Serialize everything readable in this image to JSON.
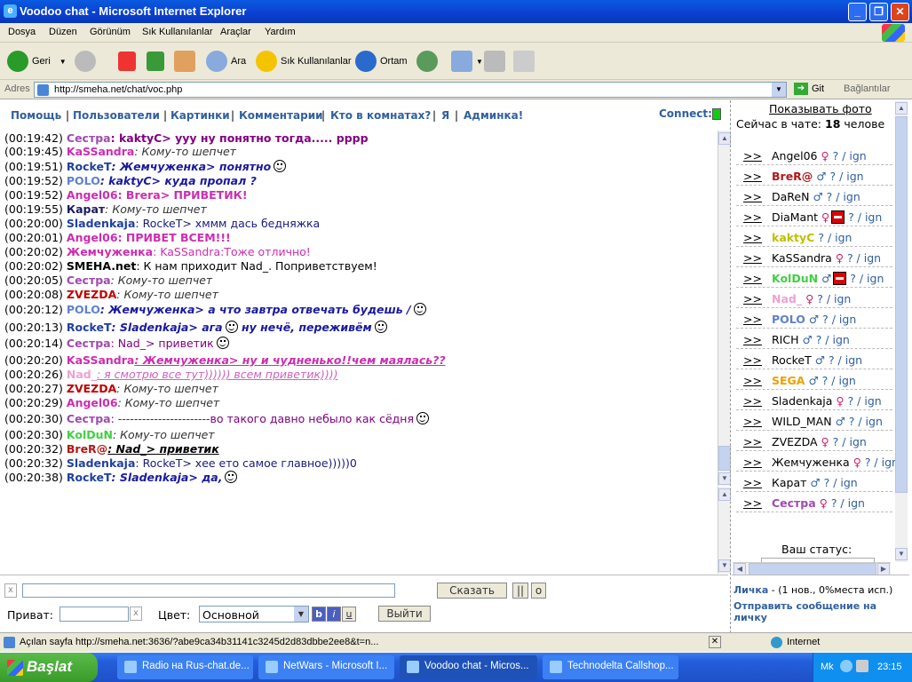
{
  "window": {
    "title": "Voodoo chat - Microsoft Internet Explorer",
    "minimize": "_",
    "maximize": "❐",
    "close": "✕"
  },
  "menu": [
    "Dosya",
    "Düzen",
    "Görünüm",
    "Sık Kullanılanlar",
    "Araçlar",
    "Yardım"
  ],
  "toolbar": {
    "back": "Geri",
    "search": "Ara",
    "favorites": "Sık Kullanılanlar",
    "media": "Ortam"
  },
  "address": {
    "label": "Adres",
    "url": "http://smeha.net/chat/voc.php",
    "go": "Git",
    "links": "Bağlantılar"
  },
  "nav": {
    "items": [
      "Помощь",
      "Пользователи",
      "Картинки",
      "Комментарии",
      "Кто в комнатах?",
      "Я",
      "Админка!"
    ],
    "connect": "Connect:"
  },
  "chat": [
    {
      "time": "(00:19:42)",
      "nick": "Сестра",
      "nick_color": "#a04ab0",
      "text": ": kaktyC> ууу ну понятно тогда..... рррр",
      "text_color": "#800080",
      "bold_text": true
    },
    {
      "time": "(00:19:45)",
      "nick": "KaSSandra",
      "nick_color": "#cc2db0",
      "text": ": Кому-то шепчет",
      "text_color": "#333",
      "italic": true
    },
    {
      "time": "(00:19:51)",
      "nick": "RockeT",
      "nick_color": "#2040a0",
      "text": ": Жемчуженка> понятно",
      "text_color": "#1a1aa0",
      "italic": true,
      "bold_text": true,
      "smiles": 1
    },
    {
      "time": "(00:19:52)",
      "nick": "POLO",
      "nick_color": "#6080d0",
      "text": ": kaktyC> куда пропал ?",
      "text_color": "#1a1aa0",
      "italic": true,
      "bold_text": true
    },
    {
      "time": "(00:19:52)",
      "nick": "Angel06",
      "nick_color": "#cc2db0",
      "text": ": Brera> ПРИВЕТИК!",
      "text_color": "#cc2db0",
      "bold_text": true
    },
    {
      "time": "(00:19:55)",
      "nick": "Карат",
      "nick_color": "#1a1a60",
      "text": ": Кому-то шепчет",
      "text_color": "#333",
      "italic": true
    },
    {
      "time": "(00:20:00)",
      "nick": "Sladenkaja",
      "nick_color": "#2040a0",
      "text": ": RockeT> хммм дась бедняжка",
      "text_color": "#1a1a80"
    },
    {
      "time": "(00:20:01)",
      "nick": "Angel06",
      "nick_color": "#cc2db0",
      "text": ": ПРИВЕТ ВСЕМ!!!",
      "text_color": "#cc2db0",
      "bold_text": true
    },
    {
      "time": "(00:20:02)",
      "nick": "Жемчуженка",
      "nick_color": "#cc2db0",
      "text": ": KaSSandra:Тоже отлично!",
      "text_color": "#cc2db0"
    },
    {
      "time": "(00:20:02)",
      "nick": "SMEHA.net",
      "nick_color": "#000000",
      "text": ": К нам приходит Nad_. Поприветствуем!",
      "text_color": "#000"
    },
    {
      "time": "(00:20:05)",
      "nick": "Сестра",
      "nick_color": "#a04ab0",
      "text": ": Кому-то шепчет",
      "text_color": "#333",
      "italic": true
    },
    {
      "time": "(00:20:08)",
      "nick": "ZVEZDA",
      "nick_color": "#c00000",
      "text": ": Кому-то шепчет",
      "text_color": "#333",
      "italic": true
    },
    {
      "time": "(00:20:12)",
      "nick": "POLO",
      "nick_color": "#6080d0",
      "text": ": Жемчуженка> а что завтра отвечать будешь /",
      "text_color": "#1a1aa0",
      "italic": true,
      "bold_text": true,
      "smiles": 1
    },
    {
      "time": "(00:20:13)",
      "nick": "RockeT",
      "nick_color": "#2040a0",
      "text": ": Sladenkaja> ага",
      "text_color": "#1a1aa0",
      "italic": true,
      "bold_text": true,
      "smiles": 1,
      "text2": " ну нечё, переживём",
      "smiles2": 1
    },
    {
      "time": "(00:20:14)",
      "nick": "Сестра",
      "nick_color": "#a04ab0",
      "text": ": Nad_> приветик",
      "text_color": "#800080",
      "smiles": 1
    },
    {
      "time": "(00:20:20)",
      "nick": "KaSSandra",
      "nick_color": "#cc2db0",
      "text": ": Жемчуженка> ну и чудненько!!чем маялась??",
      "text_color": "#cc2db0",
      "italic": true,
      "bold_text": true,
      "underline": true
    },
    {
      "time": "(00:20:26)",
      "nick": "Nad_",
      "nick_color": "#f0a0d0",
      "text": ": я смотрю все тут)))))) всем приветик))))",
      "text_color": "#d060c0",
      "italic": true,
      "underline": true
    },
    {
      "time": "(00:20:27)",
      "nick": "ZVEZDA",
      "nick_color": "#c00000",
      "text": ": Кому-то шепчет",
      "text_color": "#333",
      "italic": true
    },
    {
      "time": "(00:20:29)",
      "nick": "Angel06",
      "nick_color": "#cc2db0",
      "text": ": Кому-то шепчет",
      "text_color": "#333",
      "italic": true
    },
    {
      "time": "(00:20:30)",
      "nick": "Сестра",
      "nick_color": "#a04ab0",
      "text": ": -----------------------во такого давно небыло как сёдня",
      "text_color": "#800080",
      "smiles": 1
    },
    {
      "time": "(00:20:30)",
      "nick": "KolDuN",
      "nick_color": "#40d040",
      "text": ": Кому-то шепчет",
      "text_color": "#333",
      "italic": true
    },
    {
      "time": "(00:20:32)",
      "nick": "BreR@",
      "nick_color": "#b01818",
      "text": ": Nad_> приветик",
      "text_color": "#000",
      "italic": true,
      "bold_text": true,
      "underline": true
    },
    {
      "time": "(00:20:32)",
      "nick": "Sladenkaja",
      "nick_color": "#2040a0",
      "text": ": RockeT> хее ето самое главное)))))0",
      "text_color": "#1a1a80"
    },
    {
      "time": "(00:20:38)",
      "nick": "RockeT",
      "nick_color": "#2040a0",
      "text": ": Sladenkaja> да,",
      "text_color": "#1a1aa0",
      "italic": true,
      "bold_text": true,
      "smiles": 1
    }
  ],
  "users_panel": {
    "show_photo": "Показывать фото",
    "now_in_chat": "Сейчас в чате:",
    "count": "18",
    "count_suffix": "челове",
    "users": [
      {
        "go": ">>",
        "name": "Angel06",
        "color": "#000",
        "gender": "♀",
        "ban": false,
        "rest": "? / ign"
      },
      {
        "go": ">>",
        "name": "BreR@",
        "color": "#b01818",
        "gender": "♂",
        "ban": false,
        "rest": "? / ign"
      },
      {
        "go": ">>",
        "name": "DaReN",
        "color": "#000",
        "gender": "♂",
        "ban": false,
        "rest": "? / ign"
      },
      {
        "go": ">>",
        "name": "DiaMant",
        "color": "#000",
        "gender": "♀",
        "ban": true,
        "rest": "? / ign"
      },
      {
        "go": ">>",
        "name": "kaktyC",
        "color": "#c0c000",
        "gender": "",
        "ban": false,
        "rest": "? / ign"
      },
      {
        "go": ">>",
        "name": "KaSSandra",
        "color": "#000",
        "gender": "♀",
        "ban": false,
        "rest": "? / ign"
      },
      {
        "go": ">>",
        "name": "KolDuN",
        "color": "#40d040",
        "gender": "♂",
        "ban": true,
        "rest": "? / ign"
      },
      {
        "go": ">>",
        "name": "Nad_",
        "color": "#f0a0d0",
        "gender": "♀",
        "ban": false,
        "rest": "? / ign"
      },
      {
        "go": ">>",
        "name": "POLO",
        "color": "#6080d0",
        "gender": "♂",
        "ban": false,
        "rest": "? / ign"
      },
      {
        "go": ">>",
        "name": "RICH",
        "color": "#000",
        "gender": "♂",
        "ban": false,
        "rest": "? / ign"
      },
      {
        "go": ">>",
        "name": "RockeT",
        "color": "#000",
        "gender": "♂",
        "ban": false,
        "rest": "? / ign"
      },
      {
        "go": ">>",
        "name": "SEGA",
        "color": "#f0a000",
        "gender": "♂",
        "ban": false,
        "rest": "? / ign"
      },
      {
        "go": ">>",
        "name": "Sladenkaja",
        "color": "#000",
        "gender": "♀",
        "ban": false,
        "rest": "? / ign"
      },
      {
        "go": ">>",
        "name": "WILD_MAN",
        "color": "#000",
        "gender": "♂",
        "ban": false,
        "rest": "? / ign"
      },
      {
        "go": ">>",
        "name": "ZVEZDA",
        "color": "#000",
        "gender": "♀",
        "ban": false,
        "rest": "? / ign"
      },
      {
        "go": ">>",
        "name": "Жемчуженка",
        "color": "#000",
        "gender": "♀",
        "ban": false,
        "rest": "? / ign"
      },
      {
        "go": ">>",
        "name": "Карат",
        "color": "#000",
        "gender": "♂",
        "ban": false,
        "rest": "? / ign"
      },
      {
        "go": ">>",
        "name": "Сестра",
        "color": "#a04ab0",
        "gender": "♀",
        "ban": false,
        "rest": "? / ign"
      }
    ],
    "status_label": "Ваш статус:"
  },
  "input": {
    "clear": "x",
    "say": "Сказать",
    "pause": "||",
    "o": "o",
    "privat_label": "Приват:",
    "privat_clear": "x",
    "color_label": "Цвет:",
    "color_value": "Основной",
    "bold": "b",
    "italic": "i",
    "underline": "u",
    "exit": "Выйти"
  },
  "lichka": {
    "title": "Личка",
    "info": " - (1 нов., 0%места исп.)",
    "send": "Отправить сообщение на личку"
  },
  "status": {
    "text": "Açılan sayfa http://smeha.net:3636/?abe9ca34b31141c3245d2d83dbbe2ee8&t=n...",
    "zone": "Internet"
  },
  "taskbar": {
    "start": "Başlat",
    "tasks": [
      "Radio на Rus-chat.de...",
      "NetWars - Microsoft I...",
      "Voodoo chat - Micros...",
      "Technodelta Callshop..."
    ],
    "lang": "Mk",
    "time": "23:15"
  },
  "colors": {
    "nav_blue": "#3060a0",
    "connect_green": "#11cc11",
    "xp_blue": "#0a3fd0"
  }
}
